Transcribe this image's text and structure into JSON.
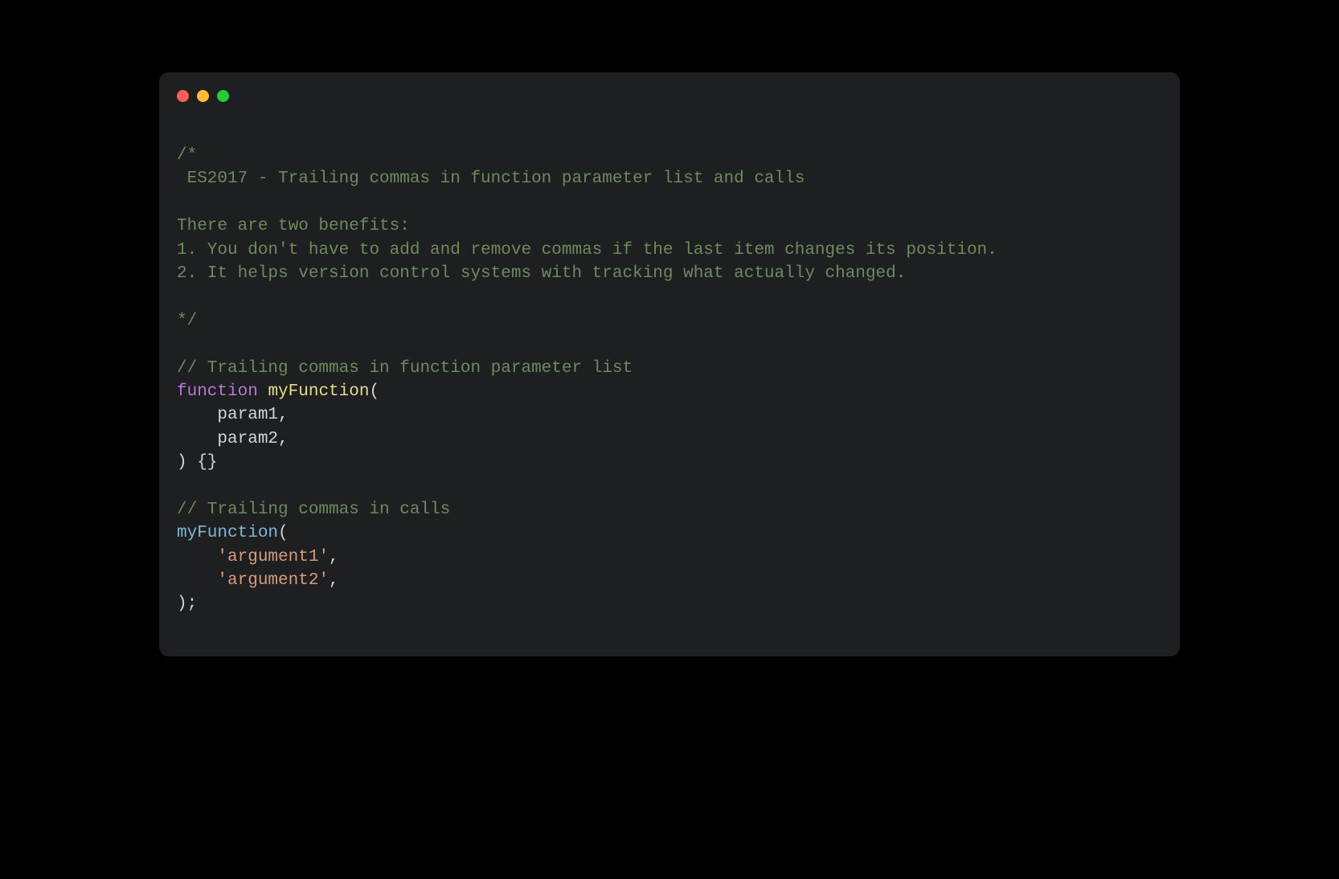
{
  "window": {
    "traffic_lights": {
      "close_color": "#ff5f56",
      "minimize_color": "#ffbd2e",
      "maximize_color": "#27c93f"
    }
  },
  "code": {
    "comment_block": {
      "open": "/*",
      "line1": " ES2017 - Trailing commas in function parameter list and calls",
      "blank": "",
      "line2": "There are two benefits:",
      "line3": "1. You don't have to add and remove commas if the last item changes its position.",
      "line4": "2. It helps version control systems with tracking what actually changed.",
      "close": "*/"
    },
    "section1": {
      "comment": "// Trailing commas in function parameter list",
      "keyword_function": "function",
      "space1": " ",
      "func_name": "myFunction",
      "open_paren": "(",
      "param1_indent": "    ",
      "param1": "param1",
      "comma1": ",",
      "param2_indent": "    ",
      "param2": "param2",
      "comma2": ",",
      "close_line": ") {}"
    },
    "section2": {
      "comment": "// Trailing commas in calls",
      "call_name": "myFunction",
      "open_paren": "(",
      "arg1_indent": "    ",
      "arg1": "'argument1'",
      "comma1": ",",
      "arg2_indent": "    ",
      "arg2": "'argument2'",
      "comma2": ",",
      "close_line": ");"
    }
  }
}
